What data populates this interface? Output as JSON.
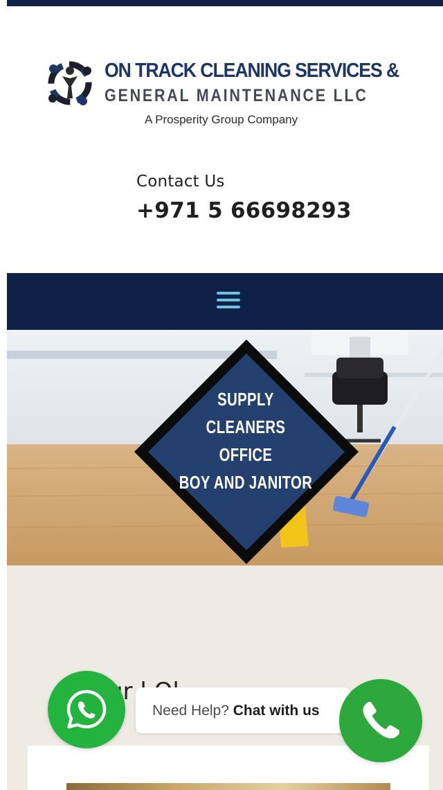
{
  "header": {
    "logo": {
      "line1": "ON TRACK CLEANING SERVICES &",
      "line2": "GENERAL MAINTENANCE LLC",
      "line3": "A Prosperity Group Company",
      "icon": "logo-emblem-icon"
    },
    "contact": {
      "label": "Contact Us",
      "phone": "+971 5 66698293"
    }
  },
  "nav": {
    "menu_icon": "hamburger-menu-icon"
  },
  "hero": {
    "badge_lines": [
      "SUPPLY",
      "CLEANERS",
      "OFFICE",
      "BOY AND JANITOR"
    ]
  },
  "section": {
    "partial_heading": "ur  l  Ol  .   .   ."
  },
  "chat": {
    "prefix": "Need Help?",
    "action": "Chat with us",
    "whatsapp_icon": "whatsapp-icon",
    "call_icon": "phone-icon"
  },
  "colors": {
    "navy": "#0f2147",
    "menu_accent": "#6ec1e4",
    "whatsapp_green": "#25b33f",
    "call_green": "#2ca83c",
    "beige": "#eeebe5"
  }
}
